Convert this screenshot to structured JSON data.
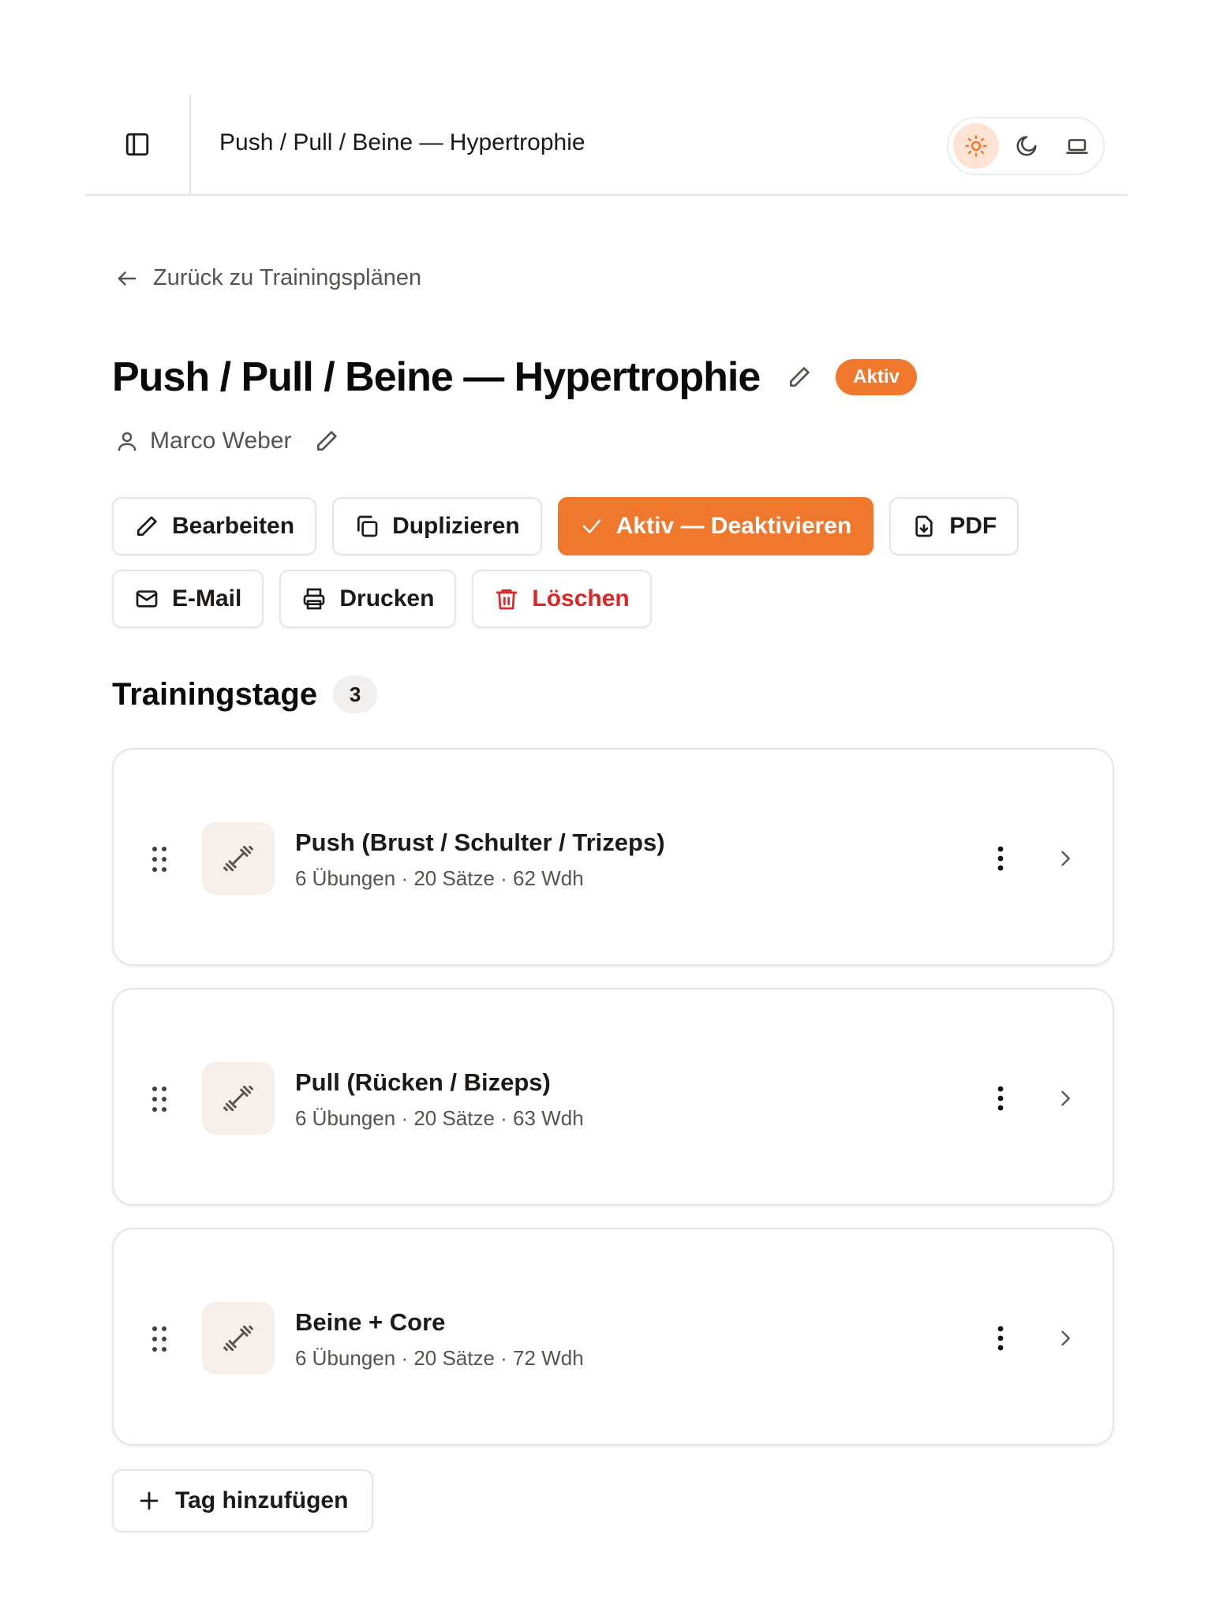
{
  "header": {
    "sidebar_icon": "panel-left-icon",
    "title": "Push / Pull / Beine — Hypertrophie",
    "theme_options": [
      {
        "name": "light",
        "icon": "sun-icon",
        "active": true
      },
      {
        "name": "dark",
        "icon": "moon-icon",
        "active": false
      },
      {
        "name": "system",
        "icon": "laptop-icon",
        "active": false
      }
    ]
  },
  "back_link": {
    "label": "Zurück zu Trainingsplänen",
    "icon": "arrow-left-icon"
  },
  "plan": {
    "title": "Push / Pull / Beine — Hypertrophie",
    "status": "Aktiv",
    "owner": "Marco Weber"
  },
  "actions": {
    "edit": "Bearbeiten",
    "duplicate": "Duplizieren",
    "toggle_active": "Aktiv — Deaktivieren",
    "pdf": "PDF",
    "email": "E-Mail",
    "print": "Drucken",
    "delete": "Löschen"
  },
  "section": {
    "title": "Trainingstage",
    "count": "3"
  },
  "days": [
    {
      "name": "Push (Brust / Schulter / Trizeps)",
      "meta": "6 Übungen · 20 Sätze · 62 Wdh"
    },
    {
      "name": "Pull (Rücken / Bizeps)",
      "meta": "6 Übungen · 20 Sätze · 63 Wdh"
    },
    {
      "name": "Beine + Core",
      "meta": "6 Übungen · 20 Sätze · 72 Wdh"
    }
  ],
  "add_day": {
    "label": "Tag hinzufügen"
  },
  "colors": {
    "accent": "#f0782d",
    "accent_soft": "#fde3d3",
    "danger": "#dc2626",
    "icon_box": "#f7efea"
  }
}
